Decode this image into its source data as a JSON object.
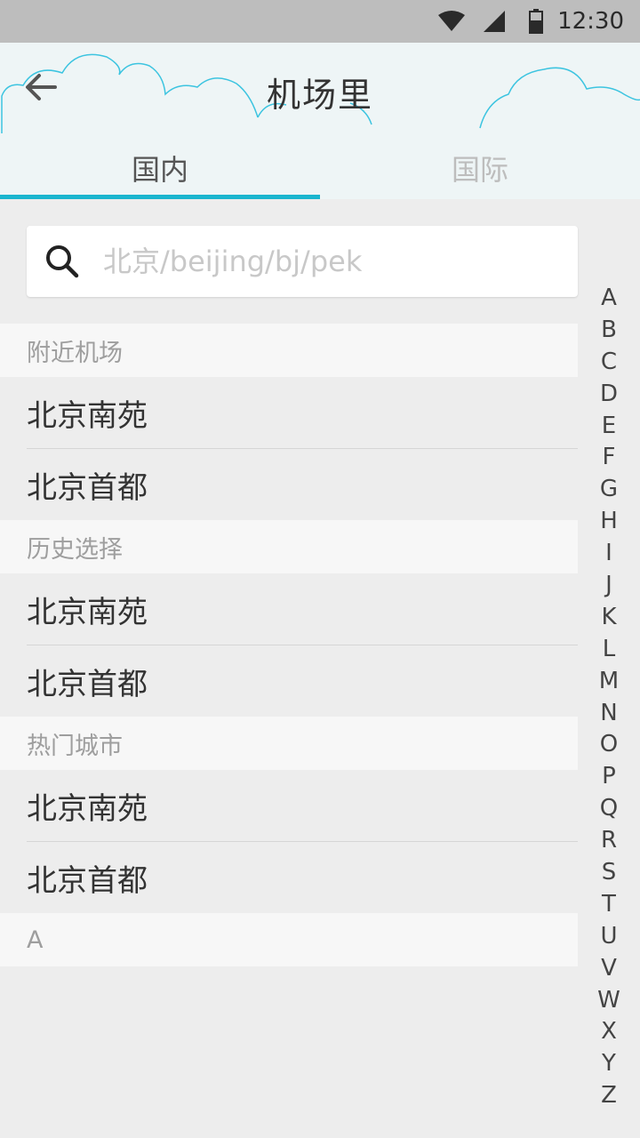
{
  "status_bar": {
    "time": "12:30"
  },
  "header": {
    "title": "机场里",
    "back_icon": "back-arrow-icon"
  },
  "tabs": [
    {
      "label": "国内",
      "active": true
    },
    {
      "label": "国际",
      "active": false
    }
  ],
  "search": {
    "placeholder": "北京/beijing/bj/pek",
    "value": ""
  },
  "sections": {
    "nearby": {
      "title": "附近机场",
      "items": [
        "北京南苑",
        "北京首都"
      ]
    },
    "history": {
      "title": "历史选择",
      "items": [
        "北京南苑",
        "北京首都"
      ]
    },
    "hot": {
      "title": "热门城市",
      "items": [
        "北京南苑",
        "北京首都"
      ]
    },
    "a": {
      "title": "A"
    }
  },
  "index_letters": [
    "A",
    "B",
    "C",
    "D",
    "E",
    "F",
    "G",
    "H",
    "I",
    "J",
    "K",
    "L",
    "M",
    "N",
    "O",
    "P",
    "Q",
    "R",
    "S",
    "T",
    "U",
    "V",
    "W",
    "X",
    "Y",
    "Z"
  ],
  "colors": {
    "accent": "#1ab5cf",
    "header_bg": "#eef5f6",
    "page_bg": "#ededed"
  }
}
